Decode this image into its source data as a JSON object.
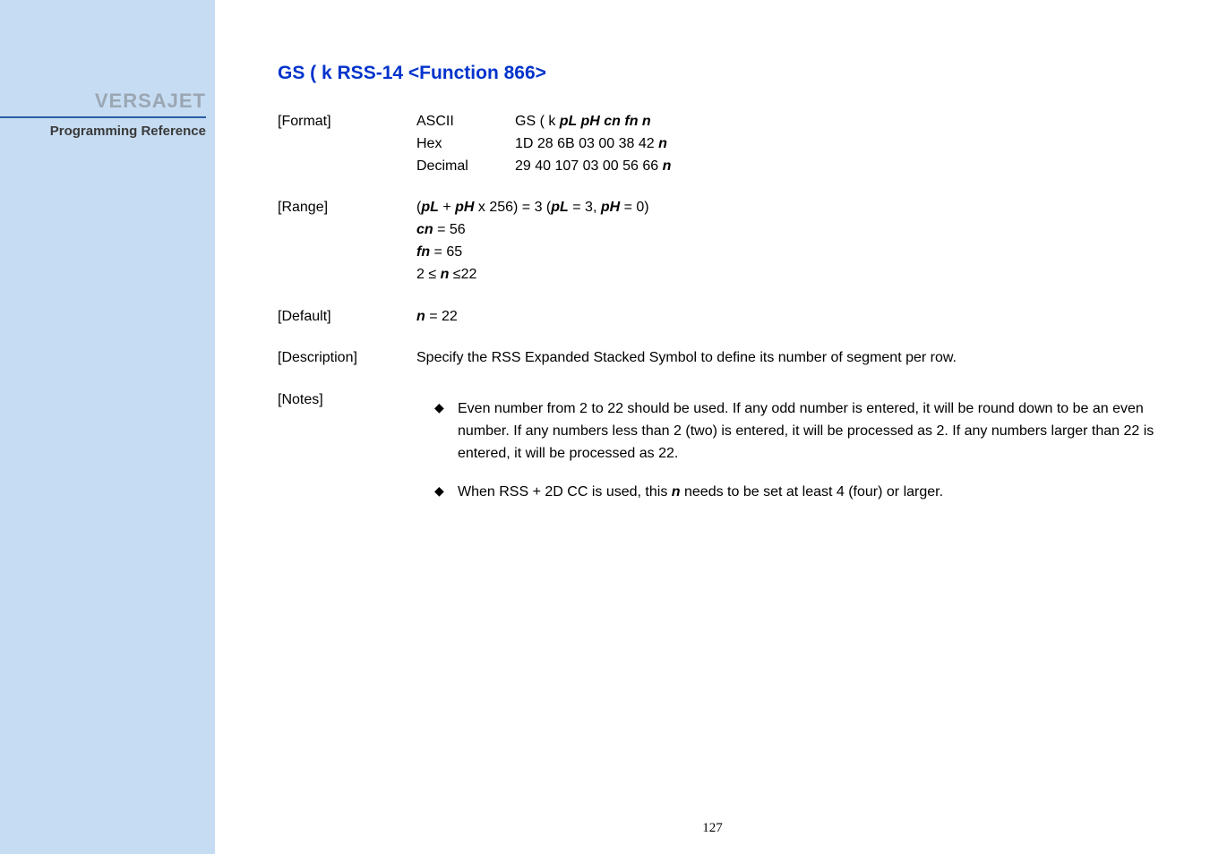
{
  "sidebar": {
    "brand": "VERSAJET",
    "subtitle": "Programming Reference"
  },
  "title": "GS ( k   RSS-14 <Function 866>",
  "format": {
    "label": "[Format]",
    "rows": [
      {
        "k": "ASCII",
        "prefix": "GS ( k ",
        "params": "pL pH cn fn n"
      },
      {
        "k": "Hex",
        "prefix": "1D 28 6B 03 00 38 42 ",
        "params": "n"
      },
      {
        "k": "Decimal",
        "prefix": "29 40 107 03 00 56 66 ",
        "params": "n"
      }
    ]
  },
  "range": {
    "label": "[Range]",
    "line1": {
      "a": "(",
      "b": "pL",
      "c": " + ",
      "d": "pH",
      "e": " x 256) = 3 (",
      "f": "pL",
      "g": " = 3, ",
      "h": "pH",
      "i": " = 0)"
    },
    "line2": {
      "a": "cn",
      "b": " = 56"
    },
    "line3": {
      "a": "fn",
      "b": " = 65"
    },
    "line4": {
      "a": "2 ≤ ",
      "b": "n",
      "c": " ≤22"
    }
  },
  "defaultSec": {
    "label": "[Default]",
    "a": "n",
    "b": " = 22"
  },
  "description": {
    "label": "[Description]",
    "text": "Specify the RSS Expanded Stacked Symbol to define its number of segment per row."
  },
  "notes": {
    "label": "[Notes]",
    "items": [
      {
        "t1": "Even number from 2 to 22 should be used. If any odd number is entered, it will be round down to be an even number. If any numbers less than 2 (two) is entered, it will be processed as 2. If any numbers larger than 22 is entered, it will be processed as 22."
      },
      {
        "t1": "When RSS + 2D CC is used, this ",
        "b": "n",
        "t2": " needs to be set at least 4 (four) or larger."
      }
    ]
  },
  "pageNumber": "127"
}
